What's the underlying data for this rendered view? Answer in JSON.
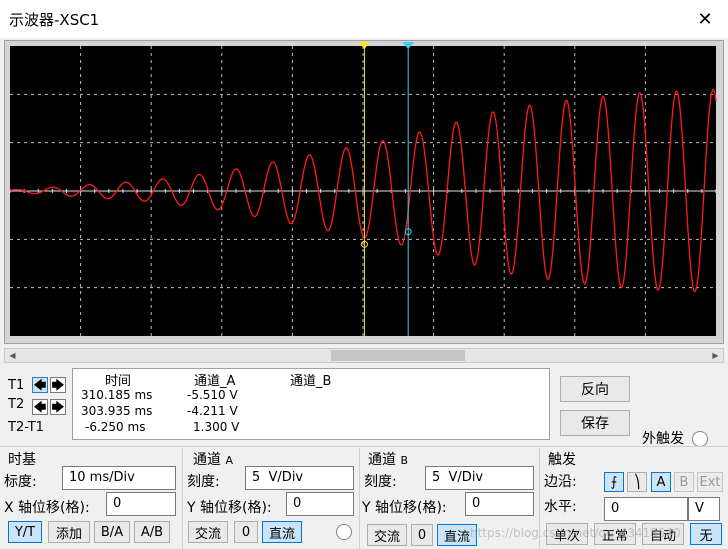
{
  "window": {
    "title": "示波器-XSC1",
    "close_glyph": "✕"
  },
  "screen": {
    "background": "#000000",
    "grid_color": "#bdbdbd",
    "trace_a_color": "#ff1a1a",
    "cursor1_color": "#ffe033",
    "cursor2_color": "#3fd0e8"
  },
  "chart_data": {
    "type": "line",
    "title": "",
    "xlabel": "",
    "ylabel": "",
    "x_unit": "ms",
    "x_per_div": 10,
    "y_per_div_A": 5,
    "divisions": {
      "x": 10,
      "y": 6
    },
    "xlim": [
      0,
      100
    ],
    "ylim": [
      -15,
      15
    ],
    "grid": true,
    "series": [
      {
        "name": "通道_A",
        "color": "#ff1a1a",
        "period_ms": 5.2,
        "envelope_x": [
          0,
          10,
          20,
          30,
          40,
          50,
          55,
          60,
          70,
          80,
          90,
          100
        ],
        "envelope_y": [
          0.1,
          0.6,
          1.1,
          2.0,
          3.4,
          4.8,
          5.5,
          6.5,
          8.5,
          9.5,
          10.2,
          10.5
        ]
      }
    ],
    "cursors": [
      {
        "name": "T1",
        "x": 50.2,
        "y": -5.51,
        "color": "#ffe033"
      },
      {
        "name": "T2",
        "x": 56.4,
        "y": -4.211,
        "color": "#3fd0e8"
      }
    ]
  },
  "scroll": {
    "left_arrow": "◀",
    "right_arrow": "▶"
  },
  "cursors_panel": {
    "t1_label": "T1",
    "t2_label": "T2",
    "diff_label": "T2-T1",
    "left_arrow": "🡄",
    "right_arrow": "🡆"
  },
  "readout": {
    "headers": [
      "时间",
      "通道_A",
      "通道_B"
    ],
    "rows": [
      [
        "310.185 ms",
        "-5.510 V",
        ""
      ],
      [
        "303.935 ms",
        "-4.211 V",
        ""
      ],
      [
        "-6.250 ms",
        "1.300 V",
        ""
      ]
    ]
  },
  "actions": {
    "reverse": "反向",
    "save": "保存",
    "ext_trigger": "外触发"
  },
  "timebase": {
    "title": "时基",
    "scale_label": "标度:",
    "scale_value": "10 ms/Div",
    "xpos_label": "X 轴位移(格):",
    "xpos_value": "0",
    "buttons": [
      "Y/T",
      "添加",
      "B/A",
      "A/B"
    ]
  },
  "channel_a": {
    "title": "通道",
    "letter": "A",
    "scale_label": "刻度:",
    "scale_value": "5  V/Div",
    "ypos_label": "Y 轴位移(格):",
    "ypos_value": "0",
    "buttons": [
      "交流",
      "0",
      "直流"
    ]
  },
  "channel_b": {
    "title": "通道",
    "letter": "B",
    "scale_label": "刻度:",
    "scale_value": "5  V/Div",
    "ypos_label": "Y 轴位移(格):",
    "ypos_value": "0",
    "buttons": [
      "交流",
      "0",
      "直流"
    ]
  },
  "trigger": {
    "title": "触发",
    "edge_label": "边沿:",
    "edge_rise": "⨍",
    "edge_fall": "⎞",
    "sources": [
      "A",
      "B",
      "Ext"
    ],
    "level_label": "水平:",
    "level_value": "0",
    "level_unit": "V",
    "modes": [
      "单次",
      "正常",
      "自动",
      "无"
    ]
  },
  "watermark": "https://blog.csdn.net/qq_43418640"
}
